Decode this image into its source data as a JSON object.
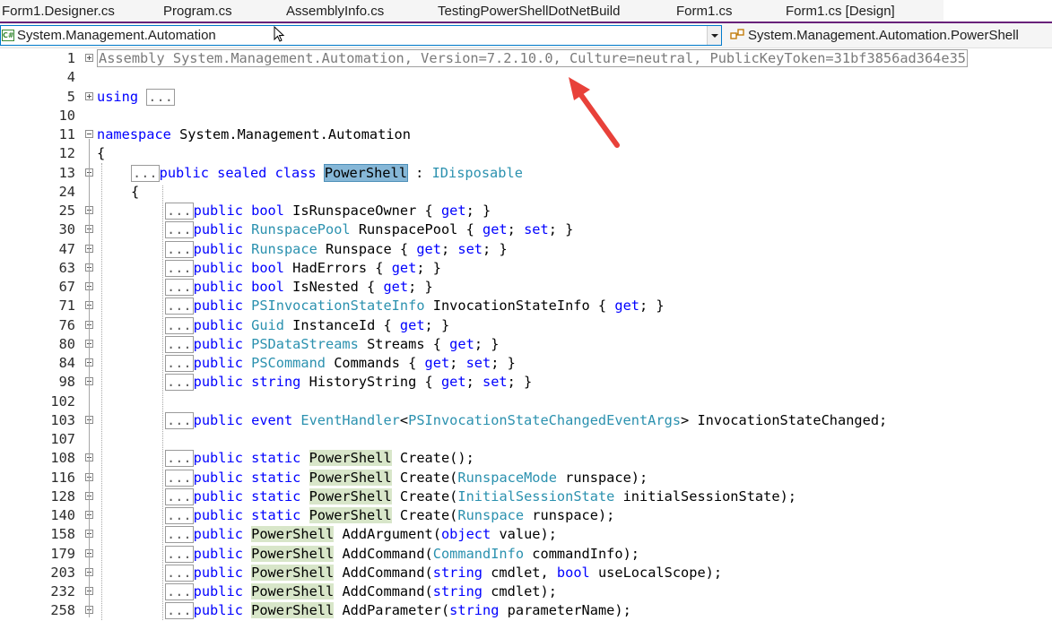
{
  "tabs": [
    {
      "label": "Form1.Designer.cs"
    },
    {
      "label": "Program.cs"
    },
    {
      "label": "AssemblyInfo.cs"
    },
    {
      "label": "TestingPowerShellDotNetBuild"
    },
    {
      "label": "Form1.cs"
    },
    {
      "label": "Form1.cs [Design]"
    }
  ],
  "navbar": {
    "project_icon": "csharp-project-icon",
    "project_icon_text": "C#",
    "namespace_value": "System.Management.Automation",
    "class_icon": "class-icon",
    "class_value": "System.Management.Automation.PowerShell"
  },
  "colors": {
    "keyword": "#0000ff",
    "type": "#2b91af",
    "reference_highlight": "#d8e6c9",
    "selection": "#86b7d7",
    "accent_tab_line": "#68217a",
    "annotation_arrow": "#e8413a"
  },
  "editor": {
    "lines": [
      {
        "num": "1",
        "fold": "plus",
        "text": "Assembly System.Management.Automation, Version=7.2.10.0, Culture=neutral, PublicKeyToken=31bf3856ad364e35"
      },
      {
        "num": "4"
      },
      {
        "num": "5",
        "fold": "plus",
        "kw": "using",
        "ellipsis": "..."
      },
      {
        "num": "10"
      },
      {
        "num": "11",
        "fold": "minus",
        "kw": "namespace",
        "text": " System.Management.Automation"
      },
      {
        "num": "12",
        "text": "{"
      },
      {
        "num": "13",
        "fold": "minus",
        "ellipsis": "...",
        "kw": "public sealed class",
        "selected": "PowerShell",
        "text": " : ",
        "type": "IDisposable"
      },
      {
        "num": "24",
        "text": "{"
      },
      {
        "num": "25",
        "fold": "plus",
        "ellipsis": "...",
        "kw": "public bool",
        "text": " IsRunspaceOwner { ",
        "kw2": "get",
        "text2": "; }"
      },
      {
        "num": "30",
        "fold": "plus",
        "ellipsis": "...",
        "kw": "public",
        "type": "RunspacePool",
        "text": " RunspacePool { ",
        "kw2": "get",
        "text2": "; ",
        "kw3": "set",
        "text3": "; }"
      },
      {
        "num": "47",
        "fold": "plus",
        "ellipsis": "...",
        "kw": "public",
        "type": "Runspace",
        "text": " Runspace { ",
        "kw2": "get",
        "text2": "; ",
        "kw3": "set",
        "text3": "; }"
      },
      {
        "num": "63",
        "fold": "plus",
        "ellipsis": "...",
        "kw": "public bool",
        "text": " HadErrors { ",
        "kw2": "get",
        "text2": "; }"
      },
      {
        "num": "67",
        "fold": "plus",
        "ellipsis": "...",
        "kw": "public bool",
        "text": " IsNested { ",
        "kw2": "get",
        "text2": "; }"
      },
      {
        "num": "71",
        "fold": "plus",
        "ellipsis": "...",
        "kw": "public",
        "type": "PSInvocationStateInfo",
        "text": " InvocationStateInfo { ",
        "kw2": "get",
        "text2": "; }"
      },
      {
        "num": "76",
        "fold": "plus",
        "ellipsis": "...",
        "kw": "public",
        "type": "Guid",
        "text": " InstanceId { ",
        "kw2": "get",
        "text2": "; }"
      },
      {
        "num": "80",
        "fold": "plus",
        "ellipsis": "...",
        "kw": "public",
        "type": "PSDataStreams",
        "text": " Streams { ",
        "kw2": "get",
        "text2": "; }"
      },
      {
        "num": "84",
        "fold": "plus",
        "ellipsis": "...",
        "kw": "public",
        "type": "PSCommand",
        "text": " Commands { ",
        "kw2": "get",
        "text2": "; ",
        "kw3": "set",
        "text3": "; }"
      },
      {
        "num": "98",
        "fold": "plus",
        "ellipsis": "...",
        "kw": "public string",
        "text": " HistoryString { ",
        "kw2": "get",
        "text2": "; ",
        "kw3": "set",
        "text3": "; }"
      },
      {
        "num": "102"
      },
      {
        "num": "103",
        "fold": "plus",
        "ellipsis": "...",
        "kw": "public event",
        "type": "EventHandler",
        "text": "<",
        "type2": "PSInvocationStateChangedEventArgs",
        "text2": "> InvocationStateChanged;"
      },
      {
        "num": "107"
      },
      {
        "num": "108",
        "fold": "plus",
        "ellipsis": "...",
        "kw": "public static",
        "hl": "PowerShell",
        "text": " Create();"
      },
      {
        "num": "116",
        "fold": "plus",
        "ellipsis": "...",
        "kw": "public static",
        "hl": "PowerShell",
        "text": " Create(",
        "type": "RunspaceMode",
        "text2": " runspace);"
      },
      {
        "num": "128",
        "fold": "plus",
        "ellipsis": "...",
        "kw": "public static",
        "hl": "PowerShell",
        "text": " Create(",
        "type": "InitialSessionState",
        "text2": " initialSessionState);"
      },
      {
        "num": "140",
        "fold": "plus",
        "ellipsis": "...",
        "kw": "public static",
        "hl": "PowerShell",
        "text": " Create(",
        "type": "Runspace",
        "text2": " runspace);"
      },
      {
        "num": "158",
        "fold": "plus",
        "ellipsis": "...",
        "kw": "public",
        "hl": "PowerShell",
        "text": " AddArgument(",
        "kw2": "object",
        "text2": " value);"
      },
      {
        "num": "179",
        "fold": "plus",
        "ellipsis": "...",
        "kw": "public",
        "hl": "PowerShell",
        "text": " AddCommand(",
        "type": "CommandInfo",
        "text2": " commandInfo);"
      },
      {
        "num": "203",
        "fold": "plus",
        "ellipsis": "...",
        "kw": "public",
        "hl": "PowerShell",
        "text": " AddCommand(",
        "kw2": "string",
        "text2": " cmdlet, ",
        "kw3": "bool",
        "text3": " useLocalScope);"
      },
      {
        "num": "232",
        "fold": "plus",
        "ellipsis": "...",
        "kw": "public",
        "hl": "PowerShell",
        "text": " AddCommand(",
        "kw2": "string",
        "text2": " cmdlet);"
      },
      {
        "num": "258",
        "fold": "plus",
        "ellipsis": "...",
        "kw": "public",
        "hl": "PowerShell",
        "text": " AddParameter(",
        "kw2": "string",
        "text2": " parameterName);"
      }
    ]
  }
}
